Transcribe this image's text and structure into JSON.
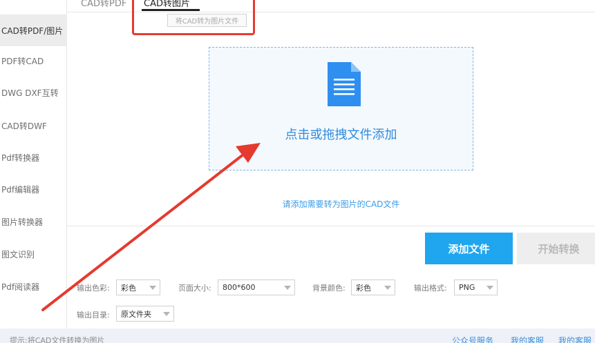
{
  "sidebar": {
    "items": [
      {
        "label": "CAD转PDF/图片",
        "active": true
      },
      {
        "label": "PDF转CAD"
      },
      {
        "label": "DWG DXF互转"
      },
      {
        "label": "CAD转DWF"
      },
      {
        "label": "Pdf转换器"
      },
      {
        "label": "Pdf编辑器"
      },
      {
        "label": "图片转换器"
      },
      {
        "label": "图文识别"
      },
      {
        "label": "Pdf阅读器"
      }
    ]
  },
  "tabs": {
    "items": [
      {
        "label": "CAD转PDF"
      },
      {
        "label": "CAD转图片",
        "active": true
      }
    ],
    "tooltip": "将CAD转为图片文件"
  },
  "dropzone": {
    "icon": "document-icon",
    "text": "点击或拖拽文件添加"
  },
  "hint": "请添加需要转为图片的CAD文件",
  "buttons": {
    "add": "添加文件",
    "start": "开始转换"
  },
  "options": {
    "color": {
      "label": "输出色彩:",
      "value": "彩色"
    },
    "page_size": {
      "label": "页面大小:",
      "value": "800*600"
    },
    "background": {
      "label": "背景颜色:",
      "value": "彩色"
    },
    "format": {
      "label": "输出格式:",
      "value": "PNG"
    },
    "output_dir": {
      "label": "输出目录:",
      "value": "原文件夹"
    }
  },
  "footer": {
    "text": "提示:将CAD文件转换为图片",
    "links": [
      "公众号服务",
      "我的客服",
      "我的客服"
    ]
  },
  "colors": {
    "accent": "#1fa6ee",
    "annotation": "#e53a2f",
    "link": "#3b8fe0"
  }
}
